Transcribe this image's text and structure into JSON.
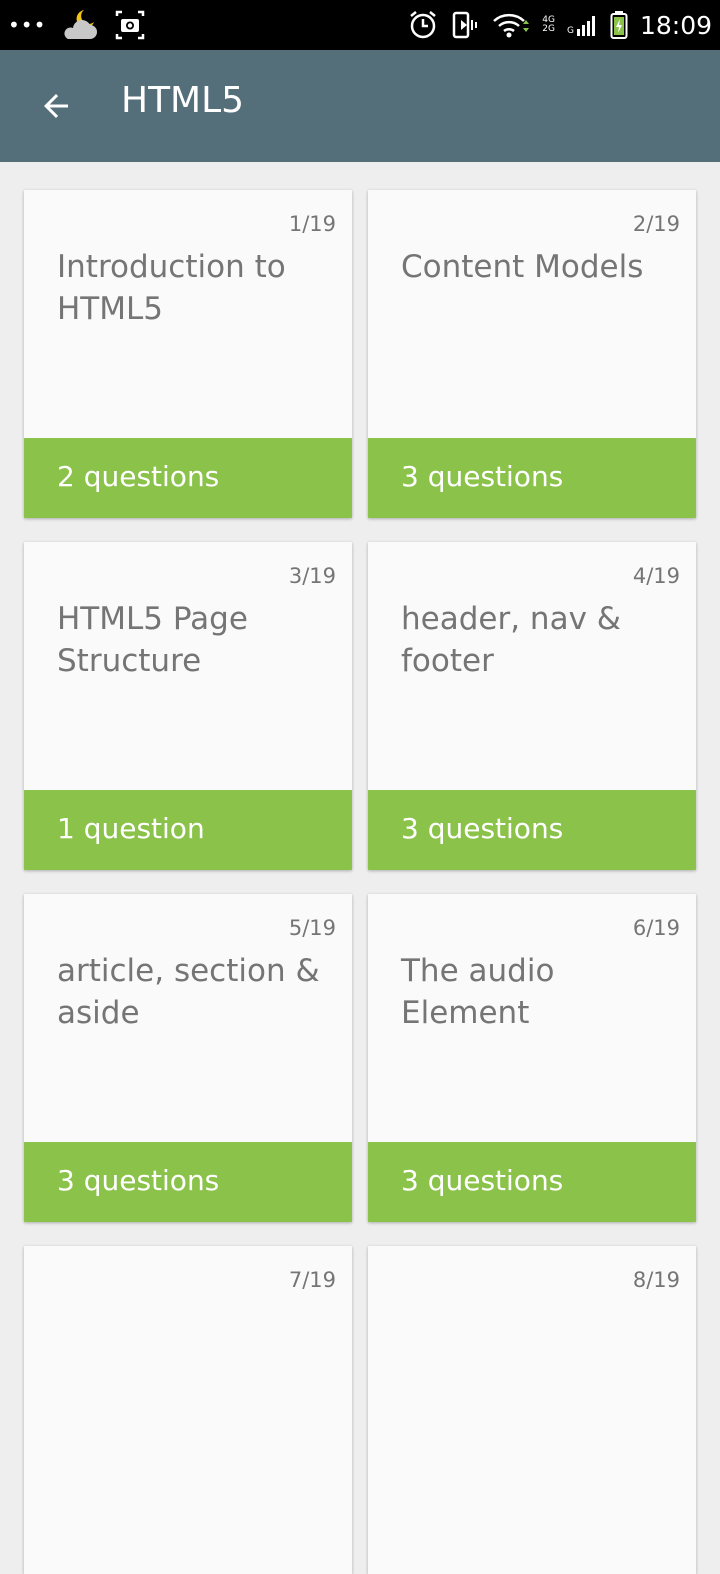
{
  "status_bar": {
    "time": "18:09",
    "network_top": "4G",
    "network_bottom": "2G",
    "signal_label": "G",
    "icons": [
      "more-dots-icon",
      "weather-cloud-moon-icon",
      "screenshot-icon",
      "alarm-icon",
      "vibrate-icon",
      "wifi-icon",
      "signal-icon",
      "battery-icon"
    ]
  },
  "app_bar": {
    "title": "HTML5",
    "back_icon": "arrow-back-icon",
    "color": "#546e7a"
  },
  "colors": {
    "accent": "#8bc34a",
    "card": "#fafafa",
    "background": "#eeeeee",
    "text_secondary": "#757575"
  },
  "cards": [
    {
      "number": "1/19",
      "title": "Introduction to HTML5",
      "questions": "2 questions"
    },
    {
      "number": "2/19",
      "title": "Content Models",
      "questions": "3 questions"
    },
    {
      "number": "3/19",
      "title": "HTML5 Page Structure",
      "questions": "1 question"
    },
    {
      "number": "4/19",
      "title": "header, nav & footer",
      "questions": "3 questions"
    },
    {
      "number": "5/19",
      "title": "article, section & aside",
      "questions": "3 questions"
    },
    {
      "number": "6/19",
      "title": "The audio Element",
      "questions": "3 questions"
    },
    {
      "number": "7/19",
      "title": "",
      "questions": ""
    },
    {
      "number": "8/19",
      "title": "",
      "questions": ""
    }
  ]
}
